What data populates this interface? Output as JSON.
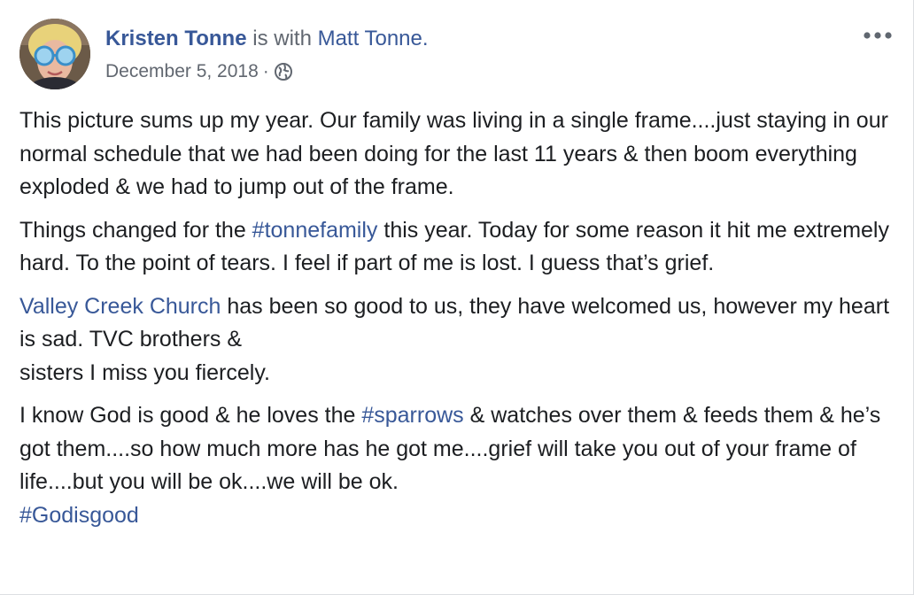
{
  "post": {
    "author": "Kristen Tonne",
    "with_text": " is with ",
    "tagged": "Matt Tonne.",
    "date": "December 5, 2018",
    "separator": "·",
    "privacy_icon": "globe-icon",
    "more_icon": "more-options-icon",
    "paragraphs": [
      {
        "text1": "This picture sums up my year. Our family was living in a single frame....just staying in our normal schedule that we had been doing for the last 11 years & then boom everything exploded & we had to jump out of the frame."
      },
      {
        "text1": "Things changed for the ",
        "link1": "#tonnefamily",
        "text2": " this year. Today for some reason it hit me extremely hard. To the point of tears. I feel if part of me is lost. I guess that’s grief."
      },
      {
        "link1": "Valley Creek Church",
        "text1": " has been so good to us, they have welcomed us, however my heart is sad. TVC brothers &",
        "text2": "sisters I miss you fiercely."
      },
      {
        "text1": "I know God is good & he loves the ",
        "link1": "#sparrows",
        "text2": " & watches over them & feeds them & he’s got them....so how much more has he got me....grief will take you out of your frame of life....but you will be ok....we will be ok.",
        "link2": "#Godisgood"
      }
    ]
  },
  "colors": {
    "link": "#385898",
    "text": "#1c1e21",
    "meta": "#616770"
  }
}
